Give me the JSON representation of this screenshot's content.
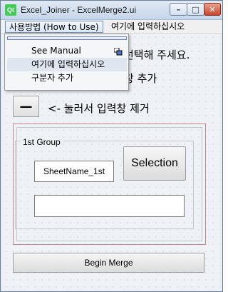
{
  "window": {
    "logo_text": "Qt",
    "title": "Excel_Joiner - ExcelMerge2.ui",
    "minimize_label": "–",
    "maximize_label": "□",
    "close_label": "✕"
  },
  "menubar": {
    "items": [
      {
        "label": "사용방법 (How to Use)"
      },
      {
        "label": "여기에 입력하십시오"
      }
    ]
  },
  "dropdown": {
    "items": [
      {
        "label": "See Manual"
      },
      {
        "label": "여기에 입력하십시오"
      },
      {
        "label": "구분자 추가"
      }
    ]
  },
  "main": {
    "line1_visible": "선택해 주세요.",
    "line2_visible": "창 추가",
    "remove_button_label": "—",
    "remove_hint": "<- 눌러서 입력창 제거",
    "group_title": "1st Group",
    "sheet_input_value": "SheetName_1st",
    "selection_button_label": "Selection",
    "second_input_value": "",
    "merge_button_label": "Begin Merge"
  },
  "colors": {
    "accent": "#41cd52",
    "container_border": "#c8888a",
    "close_button": "#c8452b"
  },
  "icons": [
    "qt-logo-icon",
    "minimize-icon",
    "maximize-icon",
    "close-icon",
    "mouse-cursor-icon"
  ]
}
